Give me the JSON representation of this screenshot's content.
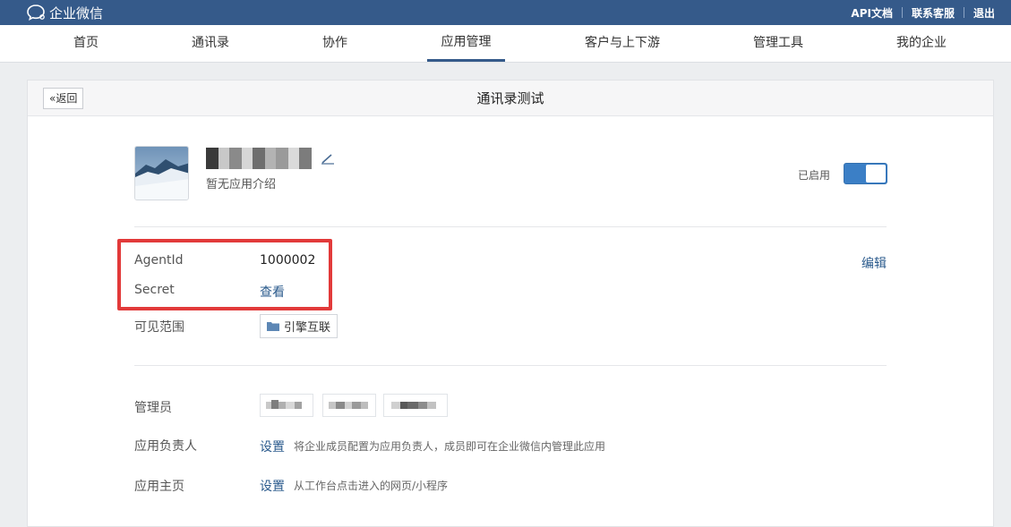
{
  "topbar": {
    "brand": "企业微信",
    "links": [
      "API文档",
      "联系客服",
      "退出"
    ]
  },
  "nav": {
    "items": [
      {
        "label": "首页",
        "active": false
      },
      {
        "label": "通讯录",
        "active": false
      },
      {
        "label": "协作",
        "active": false
      },
      {
        "label": "应用管理",
        "active": true
      },
      {
        "label": "客户与上下游",
        "active": false
      },
      {
        "label": "管理工具",
        "active": false
      },
      {
        "label": "我的企业",
        "active": false
      }
    ]
  },
  "card": {
    "back_label": "返回",
    "title": "通讯录测试"
  },
  "app": {
    "description": "暂无应用介绍",
    "status_label": "已启用",
    "enabled": true
  },
  "details": {
    "agentid_label": "AgentId",
    "agentid_value": "1000002",
    "secret_label": "Secret",
    "secret_link": "查看",
    "edit_link": "编辑",
    "visibility_label": "可见范围",
    "visibility_tag": "引擎互联"
  },
  "roles": {
    "admin_label": "管理员",
    "owner_label": "应用负责人",
    "owner_link": "设置",
    "owner_hint": "将企业成员配置为应用负责人，成员即可在企业微信内管理此应用",
    "homepage_label": "应用主页",
    "homepage_link": "设置",
    "homepage_hint": "从工作台点击进入的网页/小程序"
  },
  "colors": {
    "topbar": "#355a8a",
    "accent_link": "#2a5a8c",
    "toggle_on": "#3b7fc6",
    "highlight_box": "#e23a3a"
  }
}
